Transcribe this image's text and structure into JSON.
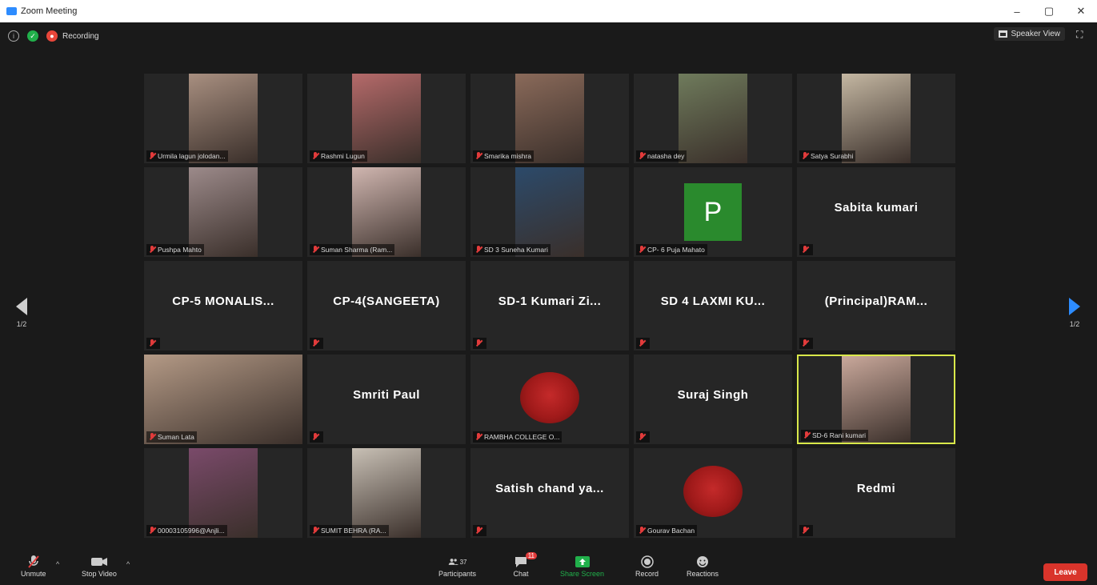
{
  "window": {
    "title": "Zoom Meeting",
    "minimize": "–",
    "maximize": "▢",
    "close": "✕"
  },
  "topbar": {
    "recording_label": "Recording",
    "speaker_view_label": "Speaker View"
  },
  "nav": {
    "left_page": "1/2",
    "right_page": "1/2"
  },
  "tiles": [
    {
      "name": "Urmila lagun jolodan...",
      "kind": "video",
      "color": "#a88f80"
    },
    {
      "name": "Rashmi Lugun",
      "kind": "video",
      "color": "#b56a6a"
    },
    {
      "name": "Smarika mishra",
      "kind": "video",
      "color": "#8a6a5a"
    },
    {
      "name": "natasha dey",
      "kind": "video",
      "color": "#6f7b5c"
    },
    {
      "name": "Satya Surabhi",
      "kind": "video",
      "color": "#c4b7a2"
    },
    {
      "name": "Pushpa Mahto",
      "kind": "video",
      "color": "#9c8a8a"
    },
    {
      "name": "Suman Sharma (Ram...",
      "kind": "video",
      "color": "#d0b6b0"
    },
    {
      "name": "SD 3 Suneha Kumari",
      "kind": "video",
      "color": "#2c4a6a"
    },
    {
      "name": "CP- 6 Puja Mahato",
      "kind": "avatar",
      "avatar": "P"
    },
    {
      "name": "",
      "kind": "text",
      "display": "Sabita kumari"
    },
    {
      "name": "",
      "kind": "text",
      "display": "CP-5 MONALIS..."
    },
    {
      "name": "",
      "kind": "text",
      "display": "CP-4(SANGEETA)"
    },
    {
      "name": "",
      "kind": "text",
      "display": "SD-1 Kumari Zi..."
    },
    {
      "name": "",
      "kind": "text",
      "display": "SD 4 LAXMI KU..."
    },
    {
      "name": "",
      "kind": "text",
      "display": "(Principal)RAM..."
    },
    {
      "name": "Suman Lata",
      "kind": "video-wide",
      "color": "#b49a86"
    },
    {
      "name": "",
      "kind": "text",
      "display": "Smriti Paul"
    },
    {
      "name": "RAMBHA COLLEGE O...",
      "kind": "logo"
    },
    {
      "name": "",
      "kind": "text",
      "display": "Suraj Singh"
    },
    {
      "name": "SD-6 Rani kumari",
      "kind": "video",
      "color": "#c9a89b",
      "active": true
    },
    {
      "name": "00003105996@Anjli...",
      "kind": "video",
      "color": "#7a4a6a"
    },
    {
      "name": "SUMIT BEHRA (RA...",
      "kind": "video",
      "color": "#c8c0b5"
    },
    {
      "name": "",
      "kind": "text",
      "display": "Satish chand ya..."
    },
    {
      "name": "Gourav Bachan",
      "kind": "logo"
    },
    {
      "name": "",
      "kind": "text",
      "display": "Redmi"
    }
  ],
  "toolbar": {
    "unmute": "Unmute",
    "stop_video": "Stop Video",
    "participants": "Participants",
    "participants_count": "37",
    "chat": "Chat",
    "chat_badge": "11",
    "share_screen": "Share Screen",
    "record": "Record",
    "reactions": "Reactions",
    "leave": "Leave"
  },
  "colors": {
    "accent": "#2d8cff",
    "active_speaker": "#d9e84a",
    "leave": "#d9342b",
    "share": "#21b04b"
  }
}
